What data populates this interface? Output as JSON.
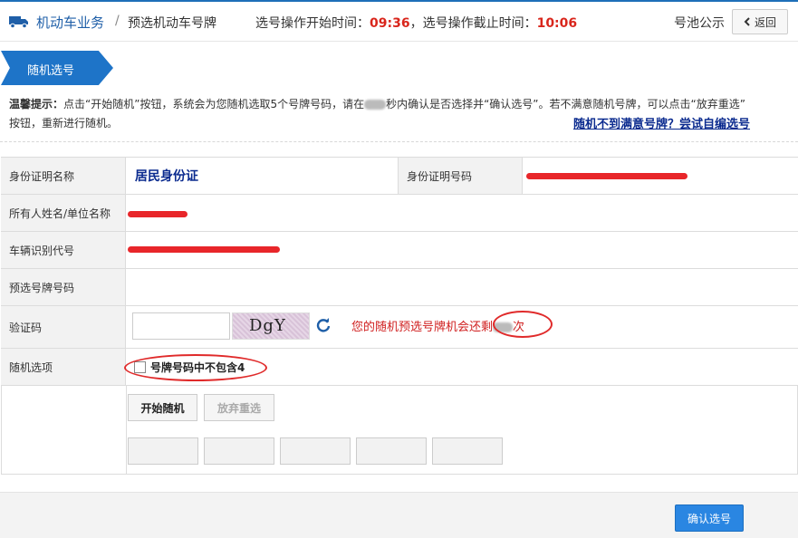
{
  "header": {
    "breadcrumb_main": "机动车业务",
    "breadcrumb_sep": "/",
    "breadcrumb_sub": "预选机动车号牌",
    "start_label": "选号操作开始时间：",
    "start_time": "09:36",
    "end_label": "，选号操作截止时间：",
    "end_time": "10:06",
    "pool_link": "号池公示",
    "back_label": "返回"
  },
  "section": {
    "tab_label": "随机选号"
  },
  "notice": {
    "title": "温馨提示：",
    "text1": "点击“开始随机”按钮，系统会为您随机选取5个号牌号码，请在",
    "text2": "秒内确认是否选择并“确认选号”。若不满意随机号牌，可以点击“放弃重选”",
    "text3": "按钮，重新进行随机。",
    "self_link": "随机不到满意号牌？尝试自编选号"
  },
  "form": {
    "id_type_label": "身份证明名称",
    "id_type_value": "居民身份证",
    "id_no_label": "身份证明号码",
    "owner_label": "所有人姓名/单位名称",
    "vin_label": "车辆识别代号",
    "plate_label": "预选号牌号码",
    "captcha_label": "验证码",
    "captcha_text": "DgY",
    "chance_before": "您的随机预选号牌机会还剩",
    "chance_after": "次",
    "option_label": "随机选项",
    "option_text": "号牌号码中不包含4"
  },
  "buttons": {
    "start": "开始随机",
    "abandon": "放弃重选",
    "confirm": "确认选号"
  },
  "colors": {
    "accent": "#1e74c8",
    "alert": "#d9261c"
  }
}
